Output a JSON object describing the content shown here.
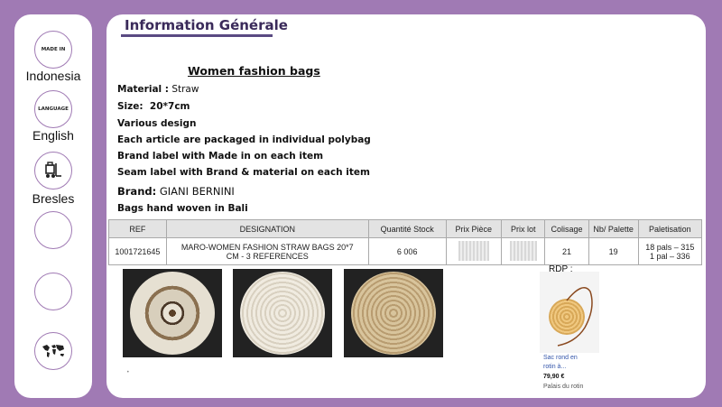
{
  "sidebar": {
    "items": [
      {
        "badge": "MADE IN",
        "label": "Indonesia"
      },
      {
        "badge": "LANGUAGE",
        "label": "English"
      },
      {
        "badge": "",
        "label": "Bresles"
      },
      {
        "badge": "",
        "label": ""
      },
      {
        "badge": "",
        "label": ""
      },
      {
        "badge": "",
        "label": ""
      }
    ]
  },
  "main": {
    "title": "Information Générale",
    "product_title": "Women fashion bags",
    "lines": {
      "material_label": "Material :",
      "material_value": " Straw",
      "size_label": "Size:",
      "size_value": "20*7cm",
      "design": "Various design",
      "packaging": "Each article are packaged in individual polybag",
      "brand_label_line": "Brand label with Made in on each item",
      "seam_label_line": "Seam label with Brand & material on each item",
      "brand_label": "Brand:",
      "brand_value": " GIANI BERNINI",
      "woven": "Bags hand woven in Bali"
    }
  },
  "table": {
    "headers": [
      "REF",
      "DESIGNATION",
      "Quantité Stock",
      "Prix Pièce",
      "Prix lot",
      "Colisage",
      "Nb/ Palette",
      "Paletisation"
    ],
    "row": {
      "ref": "1001721645",
      "designation": "MARO-WOMEN FASHION STRAW BAGS 20*7 CM - 3 REFERENCES",
      "stock": "6 006",
      "colisage": "21",
      "nb_palette": "19",
      "palet_1": "18 pals –  315",
      "palet_2": "1 pal –  336"
    }
  },
  "rdp": {
    "label": "RDP :",
    "caption_1": "Sac rond en",
    "caption_2": "rotin à...",
    "price": "79,90 €",
    "store": "Palais du rotin"
  },
  "colors": {
    "frame": "#a07ab4",
    "title": "#3a2a5a",
    "link": "#3355aa"
  }
}
